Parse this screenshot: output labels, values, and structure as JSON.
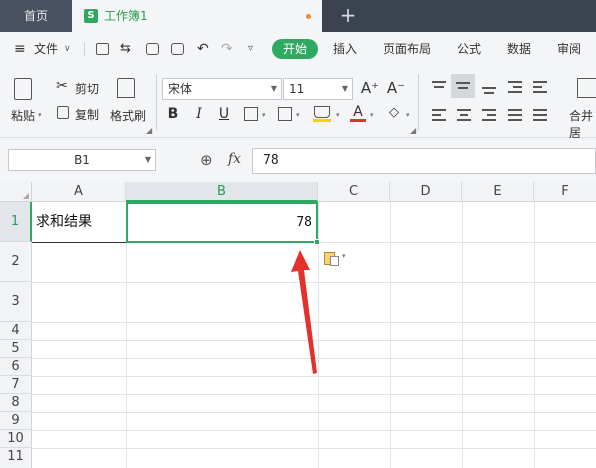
{
  "titlebar": {
    "home_tab": "首页",
    "doc_tab": "工作簿1",
    "doc_icon": "S",
    "new_tab": "+"
  },
  "menubar": {
    "file_label": "文件",
    "start": "开始",
    "items": [
      "插入",
      "页面布局",
      "公式",
      "数据",
      "审阅"
    ]
  },
  "ribbon": {
    "paste": "粘贴",
    "cut": "剪切",
    "copy": "复制",
    "format_painter": "格式刷",
    "font_name": "宋体",
    "font_size": "11",
    "grow": "A⁺",
    "shrink": "A⁻",
    "bold": "B",
    "italic": "I",
    "underline": "U",
    "merge": "合并居"
  },
  "formula": {
    "name_box": "B1",
    "fx": "fx",
    "value": "78"
  },
  "grid": {
    "columns": [
      "A",
      "B",
      "C",
      "D",
      "E",
      "F"
    ],
    "rows": [
      "1",
      "2",
      "3",
      "4",
      "5",
      "6",
      "7",
      "8",
      "9",
      "10",
      "11"
    ],
    "cells": {
      "A1": "求和结果",
      "B1": "78"
    }
  },
  "colors": {
    "accent": "#2fa862",
    "titlebar": "#3b4350",
    "arrow": "#e5312b"
  }
}
